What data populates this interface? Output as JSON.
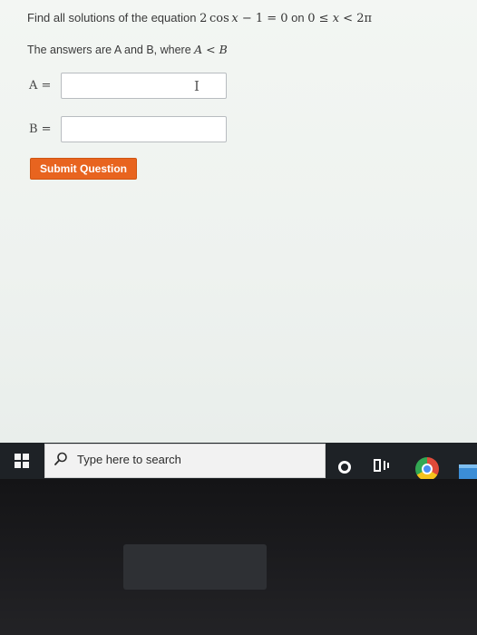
{
  "question": {
    "prefix": "Find all solutions of the equation ",
    "equation_coef": "2",
    "equation_func": "cos",
    "equation_var": "x",
    "equation_rest": " − 1 = 0",
    "on": " on ",
    "interval_lo": "0 ≤ ",
    "interval_var": "x",
    "interval_hi": " < 2π"
  },
  "answers_note": {
    "text": "The answers are A and B, where ",
    "math": "A < B"
  },
  "fields": {
    "a_label": "A =",
    "a_value": "",
    "b_label": "B =",
    "b_value": ""
  },
  "submit_label": "Submit Question",
  "taskbar": {
    "search_placeholder": "Type here to search",
    "icons": [
      "windows-start-icon",
      "search-icon",
      "cortana-icon",
      "task-view-icon",
      "chrome-icon",
      "file-explorer-icon"
    ]
  },
  "colors": {
    "submit_bg": "#e8641f",
    "taskbar_bg": "#1e2226",
    "active_indicator": "#c8d86a"
  }
}
